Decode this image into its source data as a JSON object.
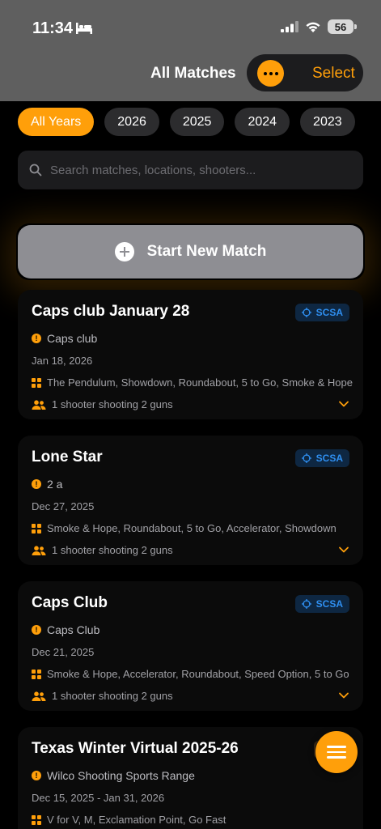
{
  "status_bar": {
    "time": "11:34",
    "battery": "56"
  },
  "nav": {
    "title": "All Matches",
    "select_label": "Select"
  },
  "years": [
    "All Years",
    "2026",
    "2025",
    "2024",
    "2023"
  ],
  "search": {
    "placeholder": "Search matches, locations, shooters..."
  },
  "start_button": {
    "label": "Start New Match"
  },
  "matches": [
    {
      "title": "Caps club January 28",
      "badge": "SCSA",
      "location": "Caps club",
      "date": "Jan 18, 2026",
      "stages": "The Pendulum, Showdown, Roundabout, 5 to Go, Smoke & Hope",
      "shooters": "1 shooter shooting 2 guns"
    },
    {
      "title": "Lone Star",
      "badge": "SCSA",
      "location": "2 a",
      "date": "Dec 27, 2025",
      "stages": "Smoke & Hope, Roundabout, 5 to Go, Accelerator, Showdown",
      "shooters": "1 shooter shooting 2 guns"
    },
    {
      "title": "Caps Club",
      "badge": "SCSA",
      "location": "Caps Club",
      "date": "Dec 21, 2025",
      "stages": "Smoke & Hope, Accelerator, Roundabout, Speed Option, 5 to Go",
      "shooters": "1 shooter shooting 2 guns"
    },
    {
      "title": "Texas Winter Virtual 2025-26",
      "location": "Wilco Shooting Sports Range",
      "date": "Dec 15, 2025 - Jan 31, 2026",
      "stages": "V for V, M, Exclamation Point, Go Fast"
    }
  ],
  "colors": {
    "accent": "#ff9f0a",
    "header": "#5f5f5f",
    "badge_text": "#2f8ff0",
    "background": "#000000"
  }
}
